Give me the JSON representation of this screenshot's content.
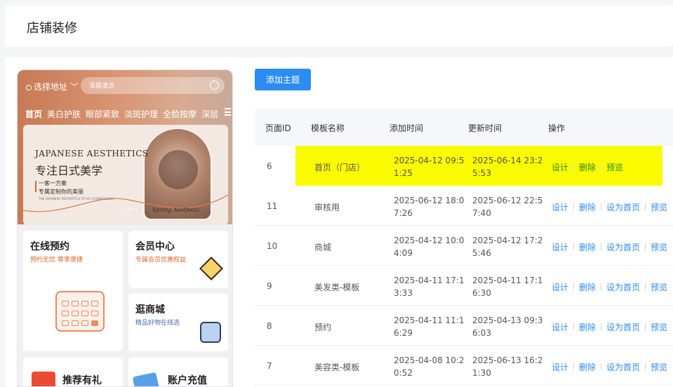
{
  "header": {
    "title": "店铺装修"
  },
  "preview": {
    "address": "选择地址",
    "search_placeholder": "深层清洁",
    "categories": [
      "首页",
      "美白护肤",
      "眼部紧致",
      "淡斑护理",
      "全脸按摩",
      "深层"
    ],
    "banner": {
      "en": "JAPANESE AESTHETICS",
      "cn": "专注日式美学",
      "sub1": "一客一方案",
      "sub2": "专属定制你的美丽",
      "tiny": "THE JAPANESE AESTHETICS STYLE COSMETOLOGY",
      "signature": "Spring Aesthetic"
    },
    "cards": [
      {
        "title": "在线预约",
        "subtitle": "预约无忧 尊享便捷"
      },
      {
        "title": "会员中心",
        "subtitle": "专属会员优惠权益"
      },
      {
        "title": "逛商城",
        "subtitle": "精品好物在线选"
      },
      {
        "title": "推荐有礼"
      },
      {
        "title": "账户充值"
      }
    ]
  },
  "toolbar": {
    "add_label": "添加主题"
  },
  "table": {
    "columns": [
      "页面ID",
      "模板名称",
      "添加时间",
      "更新时间",
      "操作"
    ],
    "rows": [
      {
        "id": "6",
        "name": "首页（门店）",
        "added": "2025-04-12 09:51:25",
        "updated": "2025-06-14 23:25:53",
        "ops": [
          "设计",
          "删除",
          "预览"
        ]
      },
      {
        "id": "11",
        "name": "审核用",
        "added": "2025-06-12 18:07:26",
        "updated": "2025-06-12 22:57:40",
        "ops": [
          "设计",
          "删除",
          "设为首页",
          "预览"
        ]
      },
      {
        "id": "10",
        "name": "商城",
        "added": "2025-04-12 10:04:09",
        "updated": "2025-04-12 17:25:46",
        "ops": [
          "设计",
          "删除",
          "设为首页",
          "预览"
        ]
      },
      {
        "id": "9",
        "name": "美发类-模板",
        "added": "2025-04-11 17:13:33",
        "updated": "2025-04-11 17:16:30",
        "ops": [
          "设计",
          "删除",
          "设为首页",
          "预览"
        ]
      },
      {
        "id": "8",
        "name": "预约",
        "added": "2025-04-11 11:16:29",
        "updated": "2025-04-13 09:36:03",
        "ops": [
          "设计",
          "删除",
          "设为首页",
          "预览"
        ]
      },
      {
        "id": "7",
        "name": "美容类-模板",
        "added": "2025-04-08 10:20:52",
        "updated": "2025-06-13 16:21:30",
        "ops": [
          "设计",
          "删除",
          "设为首页",
          "预览"
        ]
      }
    ]
  },
  "colors": {
    "primary": "#2d8cf0",
    "highlight": "#fbfb00",
    "accent": "#e0672c"
  }
}
